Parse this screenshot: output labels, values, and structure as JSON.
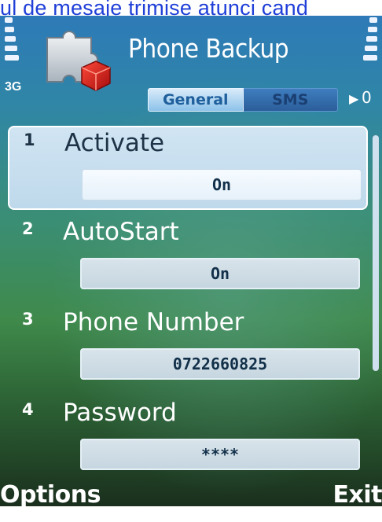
{
  "caption": {
    "text": "ul de mesaje trimise atunci cand"
  },
  "status_bar": {
    "network": "3G"
  },
  "header": {
    "title": "Phone Backup",
    "tabs": [
      {
        "label": "General",
        "active": true
      },
      {
        "label": "SMS",
        "active": false
      }
    ],
    "tab_counter": "0"
  },
  "settings": [
    {
      "index": "1",
      "label": "Activate",
      "value": "On",
      "selected": true
    },
    {
      "index": "2",
      "label": "AutoStart",
      "value": "On",
      "selected": false
    },
    {
      "index": "3",
      "label": "Phone Number",
      "value": "0722660825",
      "selected": false
    },
    {
      "index": "4",
      "label": "Password",
      "value": "****",
      "selected": false
    }
  ],
  "softkeys": {
    "left": "Options",
    "right": "Exit"
  },
  "icons": {
    "app": "puzzle-piece-icon",
    "signal": "signal-strength-icon",
    "battery": "battery-level-icon",
    "tab_next": "arrow-right-icon"
  },
  "colors": {
    "caption_text": "#1f3fd8",
    "tab_active": "#8cc2ea",
    "selected_row": "#d7e8f6"
  }
}
